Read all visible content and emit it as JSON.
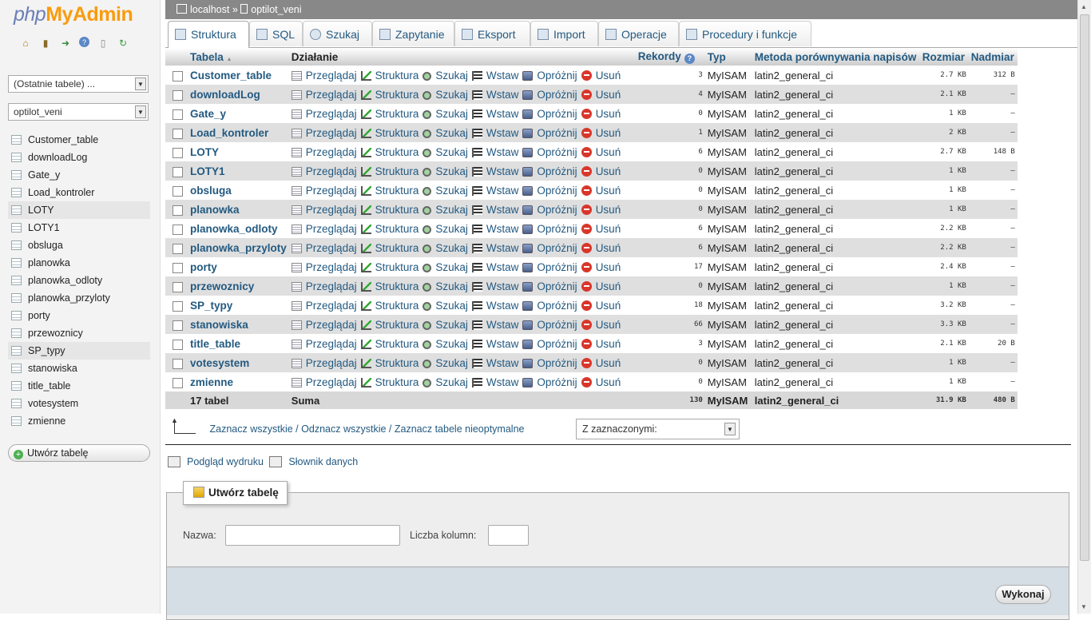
{
  "logo": {
    "php": "php",
    "pma": "MyAdmin"
  },
  "sidebar": {
    "recent_tables": "(Ostatnie tabele) ...",
    "database": "optilot_veni",
    "tables": [
      "Customer_table",
      "downloadLog",
      "Gate_y",
      "Load_kontroler",
      "LOTY",
      "LOTY1",
      "obsluga",
      "planowka",
      "planowka_odloty",
      "planowka_przyloty",
      "porty",
      "przewoznicy",
      "SP_typy",
      "stanowiska",
      "title_table",
      "votesystem",
      "zmienne"
    ],
    "create_table": "Utwórz tabelę"
  },
  "breadcrumb": {
    "server": "localhost",
    "separator": "»",
    "database": "optilot_veni"
  },
  "tabs": [
    "Struktura",
    "SQL",
    "Szukaj",
    "Zapytanie",
    "Eksport",
    "Import",
    "Operacje",
    "Procedury i funkcje"
  ],
  "table": {
    "headers": {
      "table": "Tabela",
      "sort": "▲",
      "action": "Działanie",
      "records": "Rekordy",
      "type": "Typ",
      "collation": "Metoda porównywania napisów",
      "size": "Rozmiar",
      "overhead": "Nadmiar"
    },
    "actions": {
      "browse": "Przeglądaj",
      "structure": "Struktura",
      "search": "Szukaj",
      "insert": "Wstaw",
      "empty": "Opróżnij",
      "drop": "Usuń"
    },
    "rows": [
      {
        "name": "Customer_table",
        "records": "3",
        "type": "MyISAM",
        "collation": "latin2_general_ci",
        "size": "2.7 KB",
        "overhead": "312 B"
      },
      {
        "name": "downloadLog",
        "records": "4",
        "type": "MyISAM",
        "collation": "latin2_general_ci",
        "size": "2.1 KB",
        "overhead": "–"
      },
      {
        "name": "Gate_y",
        "records": "0",
        "type": "MyISAM",
        "collation": "latin2_general_ci",
        "size": "1 KB",
        "overhead": "–"
      },
      {
        "name": "Load_kontroler",
        "records": "1",
        "type": "MyISAM",
        "collation": "latin2_general_ci",
        "size": "2 KB",
        "overhead": "–"
      },
      {
        "name": "LOTY",
        "records": "6",
        "type": "MyISAM",
        "collation": "latin2_general_ci",
        "size": "2.7 KB",
        "overhead": "148 B"
      },
      {
        "name": "LOTY1",
        "records": "0",
        "type": "MyISAM",
        "collation": "latin2_general_ci",
        "size": "1 KB",
        "overhead": "–"
      },
      {
        "name": "obsluga",
        "records": "0",
        "type": "MyISAM",
        "collation": "latin2_general_ci",
        "size": "1 KB",
        "overhead": "–"
      },
      {
        "name": "planowka",
        "records": "0",
        "type": "MyISAM",
        "collation": "latin2_general_ci",
        "size": "1 KB",
        "overhead": "–"
      },
      {
        "name": "planowka_odloty",
        "records": "6",
        "type": "MyISAM",
        "collation": "latin2_general_ci",
        "size": "2.2 KB",
        "overhead": "–"
      },
      {
        "name": "planowka_przyloty",
        "records": "6",
        "type": "MyISAM",
        "collation": "latin2_general_ci",
        "size": "2.2 KB",
        "overhead": "–"
      },
      {
        "name": "porty",
        "records": "17",
        "type": "MyISAM",
        "collation": "latin2_general_ci",
        "size": "2.4 KB",
        "overhead": "–"
      },
      {
        "name": "przewoznicy",
        "records": "0",
        "type": "MyISAM",
        "collation": "latin2_general_ci",
        "size": "1 KB",
        "overhead": "–"
      },
      {
        "name": "SP_typy",
        "records": "18",
        "type": "MyISAM",
        "collation": "latin2_general_ci",
        "size": "3.2 KB",
        "overhead": "–"
      },
      {
        "name": "stanowiska",
        "records": "66",
        "type": "MyISAM",
        "collation": "latin2_general_ci",
        "size": "3.3 KB",
        "overhead": "–"
      },
      {
        "name": "title_table",
        "records": "3",
        "type": "MyISAM",
        "collation": "latin2_general_ci",
        "size": "2.1 KB",
        "overhead": "20 B"
      },
      {
        "name": "votesystem",
        "records": "0",
        "type": "MyISAM",
        "collation": "latin2_general_ci",
        "size": "1 KB",
        "overhead": "–"
      },
      {
        "name": "zmienne",
        "records": "0",
        "type": "MyISAM",
        "collation": "latin2_general_ci",
        "size": "1 KB",
        "overhead": "–"
      }
    ],
    "footer": {
      "count": "17 tabel",
      "label": "Suma",
      "records": "130",
      "type": "MyISAM",
      "collation": "latin2_general_ci",
      "size": "31.9 KB",
      "overhead": "480 B"
    }
  },
  "bulk": {
    "check_all": "Zaznacz wszystkie",
    "uncheck_all": "Odznacz wszystkie",
    "check_overhead": "Zaznacz tabele nieoptymalne",
    "separator": "/",
    "with_selected": "Z zaznaczonymi:"
  },
  "links": {
    "print": "Podgląd wydruku",
    "dictionary": "Słownik danych"
  },
  "create": {
    "legend": "Utwórz tabelę",
    "name_label": "Nazwa:",
    "columns_label": "Liczba kolumn:",
    "go": "Wykonaj"
  },
  "icons": [
    "home-icon",
    "exit-icon",
    "query-icon",
    "help-icon",
    "docs-icon",
    "reload-icon"
  ]
}
